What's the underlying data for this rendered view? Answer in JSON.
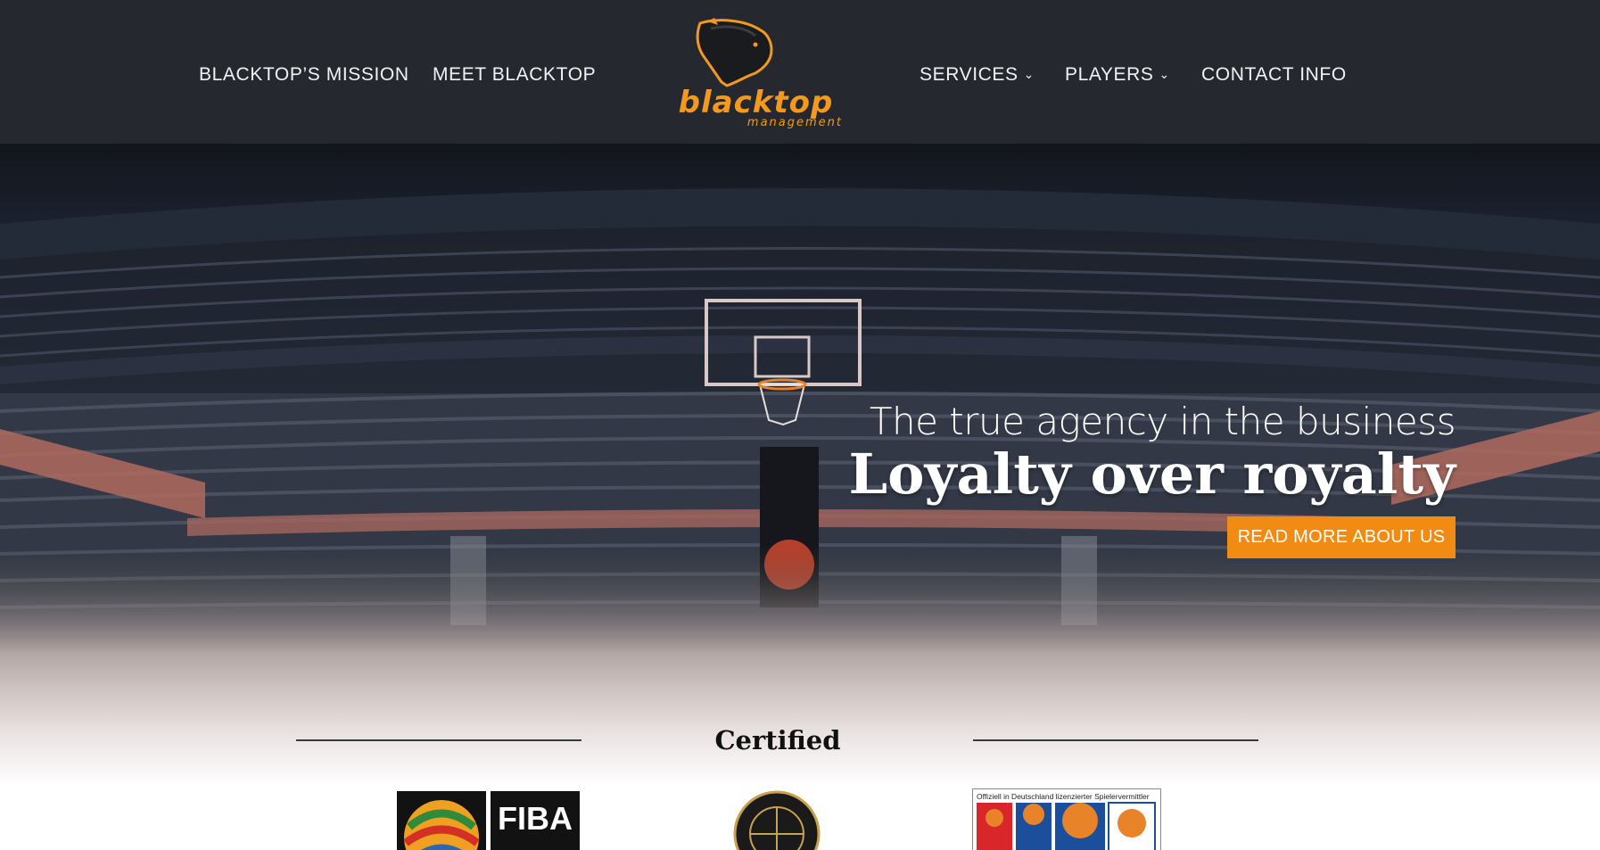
{
  "nav": {
    "left": [
      {
        "label": "BLACKTOP’S MISSION"
      },
      {
        "label": "MEET BLACKTOP"
      }
    ],
    "right": [
      {
        "label": "SERVICES",
        "has_dropdown": true
      },
      {
        "label": "PLAYERS",
        "has_dropdown": true
      },
      {
        "label": "CONTACT INFO",
        "has_dropdown": false
      }
    ],
    "chevron": "⌄"
  },
  "logo": {
    "word": "blacktop",
    "sub": "management",
    "color": "#f39a1e"
  },
  "hero": {
    "subtitle": "The true agency in the business",
    "title": "Loyalty over royalty",
    "button": "READ MORE ABOUT US",
    "button_color": "#f18b13"
  },
  "certified": {
    "title": "Certified",
    "logos": [
      {
        "name": "FIBA",
        "text": "FIBA"
      },
      {
        "name": "National Basketball Players Association"
      },
      {
        "name": "Deutscher Basketball Bund",
        "caption": "Offiziell in Deutschland lizenzierter Spielervermittler"
      }
    ]
  },
  "colors": {
    "header_bg": "#262830",
    "nav_text": "#f2f2f2"
  }
}
